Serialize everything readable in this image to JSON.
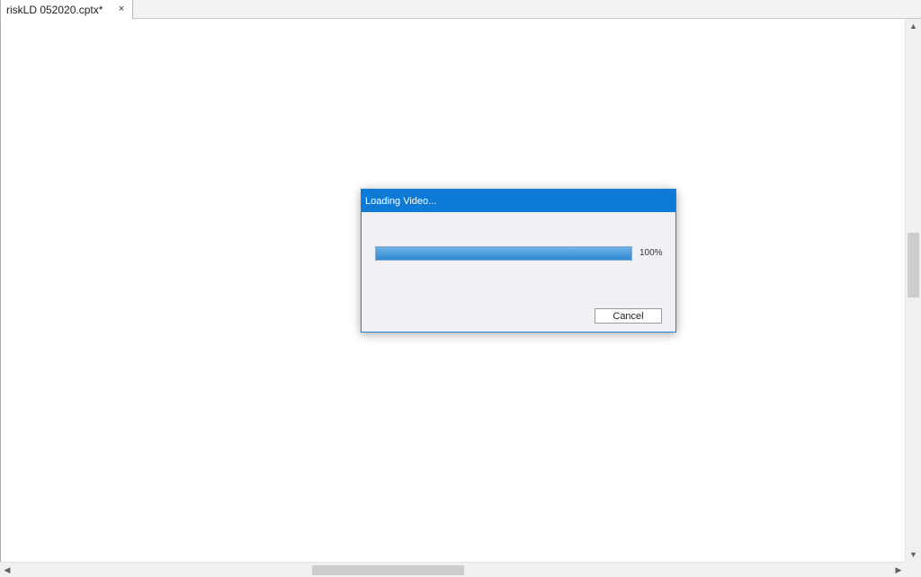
{
  "tab": {
    "title": "riskLD 052020.cptx*",
    "close_icon": "×"
  },
  "scrollbars": {
    "up": "▲",
    "down": "▼",
    "left": "◀",
    "right": "▶"
  },
  "dialog": {
    "title": "Loading Video...",
    "progress_percent": 100,
    "progress_text": "100%",
    "cancel_label": "Cancel"
  },
  "colors": {
    "title_bar": "#0e7ad8",
    "progress_fill": "#2f88d2"
  }
}
